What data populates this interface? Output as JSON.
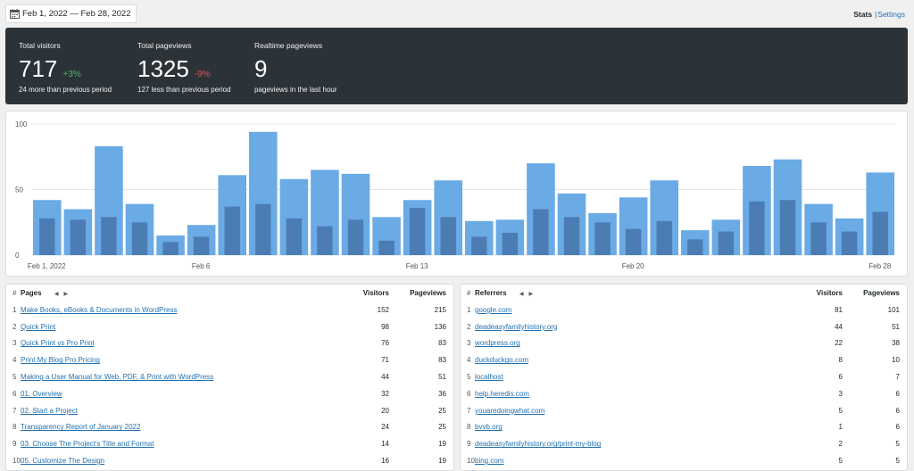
{
  "header": {
    "date_range": "Feb 1, 2022 — Feb 28, 2022",
    "nav_stats": "Stats",
    "nav_sep": "|",
    "nav_settings": "Settings"
  },
  "totals": {
    "visitors": {
      "label": "Total visitors",
      "value": "717",
      "change": "+3%",
      "sub": "24 more than previous period"
    },
    "pageviews": {
      "label": "Total pageviews",
      "value": "1325",
      "change": "-9%",
      "sub": "127 less than previous period"
    },
    "realtime": {
      "label": "Realtime pageviews",
      "value": "9",
      "sub": "pageviews in the last hour"
    }
  },
  "colors": {
    "pageviews_bar": "#6aaae5",
    "visitors_bar": "#4b7cb3",
    "positive": "#4ab866",
    "negative": "#e65054",
    "link": "#2271b1"
  },
  "chart_data": {
    "type": "bar",
    "x_ticks": [
      "Feb 1, 2022",
      "Feb 6",
      "Feb 13",
      "Feb 20",
      "Feb 28"
    ],
    "x_tick_index": [
      0,
      5,
      12,
      19,
      27
    ],
    "y_ticks": [
      "100",
      "50",
      "0"
    ],
    "ylim": [
      0,
      100
    ],
    "grid": true,
    "series": [
      {
        "values": [
          42,
          35,
          83,
          39,
          15,
          23,
          61,
          94,
          58,
          65,
          62,
          29,
          42,
          57,
          26,
          27,
          70,
          47,
          32,
          44,
          57,
          19,
          27,
          68,
          73,
          39,
          28,
          63
        ]
      },
      {
        "values": [
          28,
          27,
          29,
          25,
          10,
          14,
          37,
          39,
          28,
          22,
          27,
          11,
          36,
          29,
          14,
          17,
          35,
          29,
          25,
          20,
          26,
          12,
          18,
          41,
          42,
          25,
          18,
          33
        ]
      }
    ]
  },
  "pages": {
    "hash_label": "#",
    "title": "Pages",
    "prev_icon": "◀",
    "next_icon": "▶",
    "col_visitors": "Visitors",
    "col_pageviews": "Pageviews",
    "rows": [
      {
        "n": "1",
        "name": "Make Books, eBooks & Documents in WordPress",
        "visitors": "152",
        "pageviews": "215"
      },
      {
        "n": "2",
        "name": "Quick Print",
        "visitors": "98",
        "pageviews": "136"
      },
      {
        "n": "3",
        "name": "Quick Print vs Pro Print",
        "visitors": "76",
        "pageviews": "83"
      },
      {
        "n": "4",
        "name": "Print My Blog Pro Pricing",
        "visitors": "71",
        "pageviews": "83"
      },
      {
        "n": "5",
        "name": "Making a User Manual for Web, PDF, & Print with WordPress",
        "visitors": "44",
        "pageviews": "51"
      },
      {
        "n": "6",
        "name": "01. Overview",
        "visitors": "32",
        "pageviews": "36"
      },
      {
        "n": "7",
        "name": "02. Start a Project",
        "visitors": "20",
        "pageviews": "25"
      },
      {
        "n": "8",
        "name": "Transparency Report of January 2022",
        "visitors": "24",
        "pageviews": "25"
      },
      {
        "n": "9",
        "name": "03. Choose The Project's Title and Format",
        "visitors": "14",
        "pageviews": "19"
      },
      {
        "n": "10",
        "name": "05. Customize The Design",
        "visitors": "16",
        "pageviews": "19"
      }
    ]
  },
  "referrers": {
    "hash_label": "#",
    "title": "Referrers",
    "prev_icon": "◀",
    "next_icon": "▶",
    "col_visitors": "Visitors",
    "col_pageviews": "Pageviews",
    "rows": [
      {
        "n": "1",
        "name": "google.com",
        "visitors": "81",
        "pageviews": "101"
      },
      {
        "n": "2",
        "name": "deadeasyfamilyhistory.org",
        "visitors": "44",
        "pageviews": "51"
      },
      {
        "n": "3",
        "name": "wordpress.org",
        "visitors": "22",
        "pageviews": "38"
      },
      {
        "n": "4",
        "name": "duckduckgo.com",
        "visitors": "8",
        "pageviews": "10"
      },
      {
        "n": "5",
        "name": "localhost",
        "visitors": "6",
        "pageviews": "7"
      },
      {
        "n": "6",
        "name": "help.heredis.com",
        "visitors": "3",
        "pageviews": "6"
      },
      {
        "n": "7",
        "name": "youaredoingwhat.com",
        "visitors": "5",
        "pageviews": "6"
      },
      {
        "n": "8",
        "name": "bvvb.org",
        "visitors": "1",
        "pageviews": "6"
      },
      {
        "n": "9",
        "name": "deadeasyfamilyhistory.org/print-my-blog",
        "visitors": "2",
        "pageviews": "5"
      },
      {
        "n": "10",
        "name": "bing.com",
        "visitors": "5",
        "pageviews": "5"
      }
    ]
  }
}
